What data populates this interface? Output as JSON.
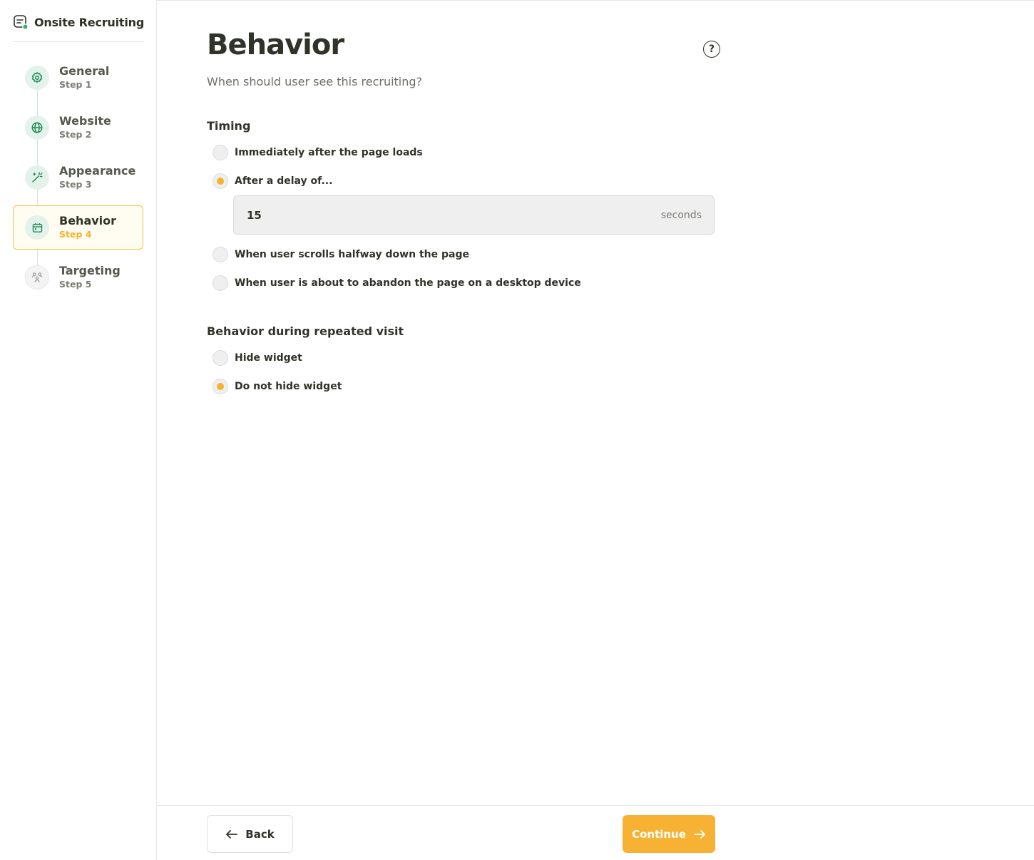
{
  "app": {
    "title": "Onsite Recruiting"
  },
  "sidebar": {
    "steps": [
      {
        "label": "General",
        "sub": "Step 1",
        "icon": "gear-icon"
      },
      {
        "label": "Website",
        "sub": "Step 2",
        "icon": "globe-icon"
      },
      {
        "label": "Appearance",
        "sub": "Step 3",
        "icon": "magic-wand-icon"
      },
      {
        "label": "Behavior",
        "sub": "Step 4",
        "icon": "calendar-icon",
        "active": true
      },
      {
        "label": "Targeting",
        "sub": "Step 5",
        "icon": "users-icon"
      }
    ]
  },
  "main": {
    "title": "Behavior",
    "help_symbol": "?",
    "subtitle": "When should user see this recruiting?",
    "timing": {
      "title": "Timing",
      "options": [
        {
          "label": "Immediately after the page loads",
          "checked": false
        },
        {
          "label": "After a delay of...",
          "checked": true
        },
        {
          "label": "When user scrolls halfway down the page",
          "checked": false
        },
        {
          "label": "When user is about to abandon the page on a desktop device",
          "checked": false
        }
      ],
      "delay": {
        "value": "15",
        "unit": "seconds"
      }
    },
    "repeated": {
      "title": "Behavior during repeated visit",
      "options": [
        {
          "label": "Hide widget",
          "checked": false
        },
        {
          "label": "Do not hide widget",
          "checked": true
        }
      ]
    }
  },
  "footer": {
    "back_label": "Back",
    "continue_label": "Continue"
  },
  "colors": {
    "accent": "#f8b233",
    "green": "#1f8a55",
    "text": "#2f3328"
  }
}
